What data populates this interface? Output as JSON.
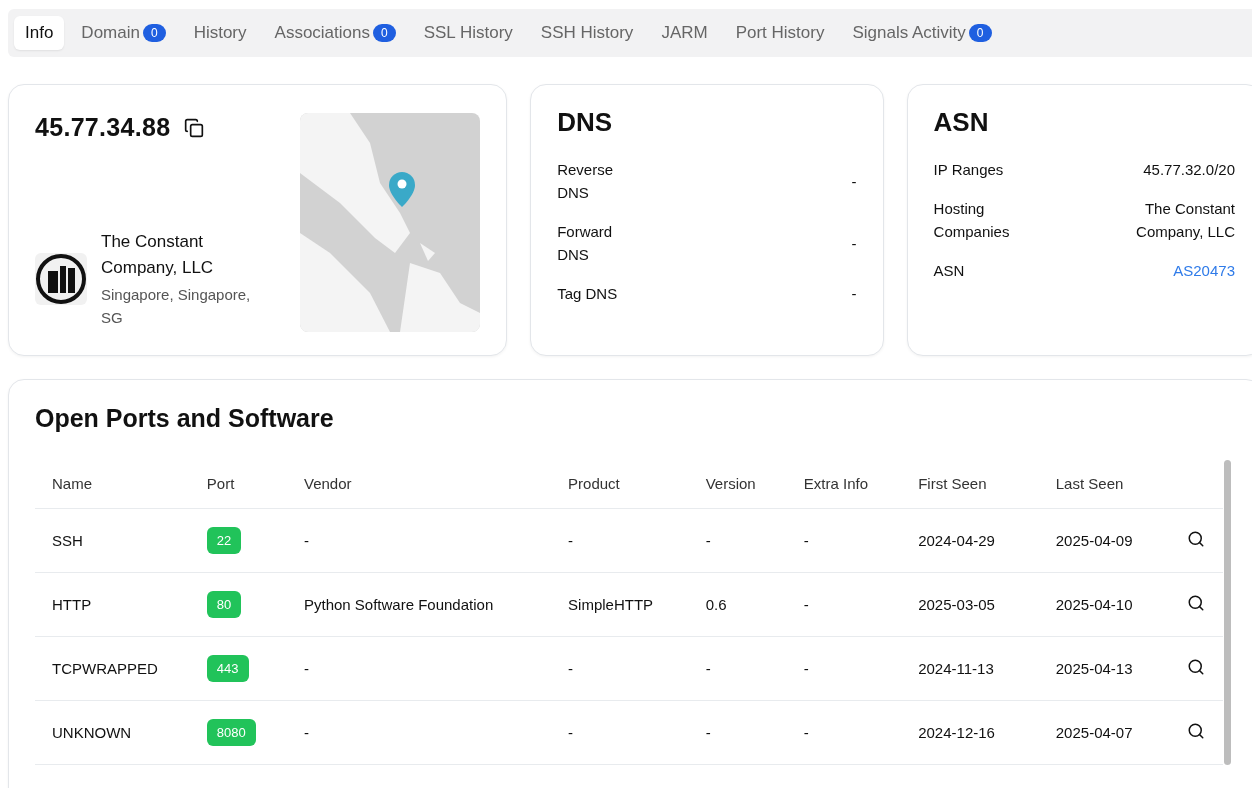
{
  "tabs": [
    {
      "label": "Info",
      "selected": true
    },
    {
      "label": "Domain",
      "badge": "0",
      "selected": false
    },
    {
      "label": "History",
      "selected": false
    },
    {
      "label": "Associations",
      "badge": "0",
      "selected": false
    },
    {
      "label": "SSL History",
      "selected": false
    },
    {
      "label": "SSH History",
      "selected": false
    },
    {
      "label": "JARM",
      "selected": false
    },
    {
      "label": "Port History",
      "selected": false
    },
    {
      "label": "Signals Activity",
      "badge": "0",
      "selected": false
    }
  ],
  "ip_card": {
    "ip": "45.77.34.88",
    "organization": "The Constant Company, LLC",
    "location": "Singapore, Singapore, SG"
  },
  "dns_card": {
    "title": "DNS",
    "rows": [
      {
        "label": "Reverse DNS",
        "value": "-"
      },
      {
        "label": "Forward DNS",
        "value": "-"
      },
      {
        "label": "Tag DNS",
        "value": "-"
      }
    ]
  },
  "asn_card": {
    "title": "ASN",
    "rows": [
      {
        "label": "IP Ranges",
        "value": "45.77.32.0/20",
        "kind": "text"
      },
      {
        "label": "Hosting Companies",
        "value": "The Constant Company, LLC",
        "kind": "text"
      },
      {
        "label": "ASN",
        "value": "AS20473",
        "kind": "link"
      }
    ]
  },
  "ports": {
    "title": "Open Ports and Software",
    "columns": [
      "Name",
      "Port",
      "Vendor",
      "Product",
      "Version",
      "Extra Info",
      "First Seen",
      "Last Seen"
    ],
    "rows": [
      [
        "SSH",
        "22",
        "-",
        "-",
        "-",
        "-",
        "2024-04-29",
        "2025-04-09"
      ],
      [
        "HTTP",
        "80",
        "Python Software Foundation",
        "SimpleHTTP",
        "0.6",
        "-",
        "2025-03-05",
        "2025-04-10"
      ],
      [
        "TCPWRAPPED",
        "443",
        "-",
        "-",
        "-",
        "-",
        "2024-11-13",
        "2025-04-13"
      ],
      [
        "UNKNOWN",
        "8080",
        "-",
        "-",
        "-",
        "-",
        "2024-12-16",
        "2025-04-07"
      ]
    ]
  }
}
